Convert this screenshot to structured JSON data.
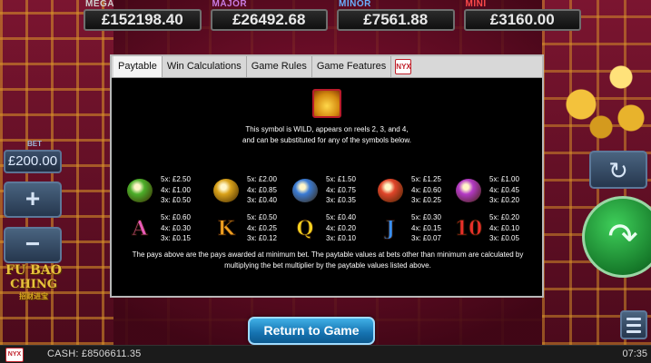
{
  "jackpots": [
    {
      "label": "MEGA",
      "value": "£152198.40"
    },
    {
      "label": "MAJOR",
      "value": "£26492.68"
    },
    {
      "label": "MINOR",
      "value": "£7561.88"
    },
    {
      "label": "MINI",
      "value": "£3160.00"
    }
  ],
  "controls": {
    "bet_label": "BET",
    "bet_value": "£200.00",
    "plus": "+",
    "minus": "−"
  },
  "logo": {
    "line1": "FU BAO",
    "line2": "CHING",
    "line3": "招财进宝"
  },
  "tabs": [
    {
      "label": "Paytable",
      "active": true
    },
    {
      "label": "Win Calculations",
      "active": false
    },
    {
      "label": "Game Rules",
      "active": false
    },
    {
      "label": "Game Features",
      "active": false
    }
  ],
  "tab_brand": "NYX",
  "wild_text": "This symbol is WILD, appears on reels 2, 3, and 4, and can be substituted for any of the symbols below.",
  "paytable_rows": [
    [
      {
        "symbol": "frog-icon",
        "color": "#4caf2a",
        "pays": [
          "5x: £2.50",
          "4x: £1.00",
          "3x: £0.50"
        ]
      },
      {
        "symbol": "gold-chest-icon",
        "color": "#d9a21a",
        "pays": [
          "5x: £2.00",
          "4x: £0.85",
          "3x: £0.40"
        ]
      },
      {
        "symbol": "porcelain-vase-icon",
        "color": "#3a7bd5",
        "pays": [
          "5x: £1.50",
          "4x: £0.75",
          "3x: £0.35"
        ]
      },
      {
        "symbol": "fan-icon",
        "color": "#e0452a",
        "pays": [
          "5x: £1.25",
          "4x: £0.60",
          "3x: £0.25"
        ]
      },
      {
        "symbol": "coin-string-icon",
        "color": "#b43ac6",
        "pays": [
          "5x: £1.00",
          "4x: £0.45",
          "3x: £0.20"
        ]
      }
    ],
    [
      {
        "symbol": "A",
        "color": "#e85ab8",
        "pays": [
          "5x: £0.60",
          "4x: £0.30",
          "3x: £0.15"
        ]
      },
      {
        "symbol": "K",
        "color": "#f0a020",
        "pays": [
          "5x: £0.50",
          "4x: £0.25",
          "3x: £0.12"
        ]
      },
      {
        "symbol": "Q",
        "color": "#f3d020",
        "pays": [
          "5x: £0.40",
          "4x: £0.20",
          "3x: £0.10"
        ]
      },
      {
        "symbol": "J",
        "color": "#3a8ff0",
        "pays": [
          "5x: £0.30",
          "4x: £0.15",
          "3x: £0.07"
        ]
      },
      {
        "symbol": "10",
        "color": "#e8302a",
        "pays": [
          "5x: £0.20",
          "4x: £0.10",
          "3x: £0.05"
        ]
      }
    ]
  ],
  "footer_text": "The pays above are the pays awarded at minimum bet. The paytable values at bets other than minimum are calculated by multiplying the bet multiplier by the paytable values listed above.",
  "return_button": "Return to Game",
  "bottom": {
    "brand": "NYX",
    "cash": "CASH: £8506611.35",
    "clock": "07:35"
  },
  "icons": {
    "refresh": "↻",
    "spin": "↷"
  }
}
